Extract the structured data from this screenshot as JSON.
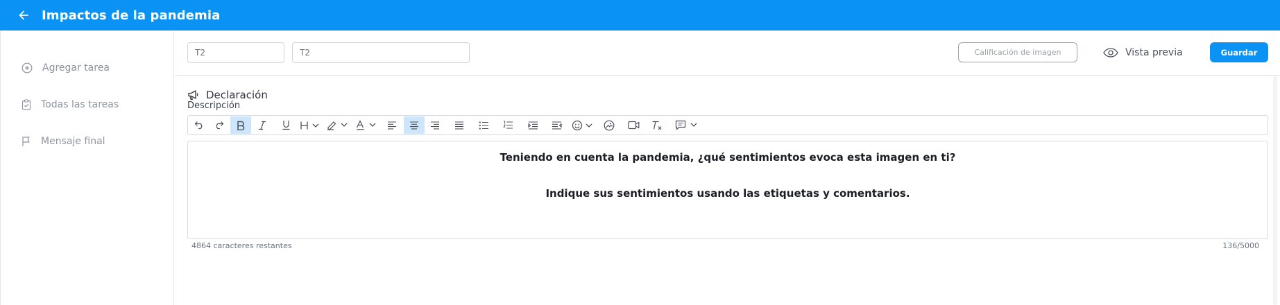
{
  "header": {
    "title": "Impactos de la pandemia",
    "back_icon": "arrow-left-icon"
  },
  "sidebar": {
    "items": [
      {
        "label": "Agregar tarea",
        "icon": "plus-circle-icon"
      },
      {
        "label": "Todas las tareas",
        "icon": "clipboard-check-icon"
      },
      {
        "label": "Mensaje final",
        "icon": "flag-icon"
      }
    ]
  },
  "toolbar": {
    "field1_value": "T2",
    "field2_value": "T2",
    "image_rating_label": "Calificación de imagen",
    "preview_label": "Vista previa",
    "save_label": "Guardar"
  },
  "statement": {
    "heading": "Declaración",
    "description_label": "Descripción",
    "paragraph1": "Teniendo en cuenta la pandemia, ¿qué sentimientos evoca esta imagen en ti?",
    "paragraph2": "Indique sus sentimientos usando las etiquetas y comentarios.",
    "chars_remaining": "4864 caracteres restantes",
    "char_count": "136/5000"
  },
  "colors": {
    "primary": "#0a93f5",
    "active_tool": "#cde6fb"
  }
}
